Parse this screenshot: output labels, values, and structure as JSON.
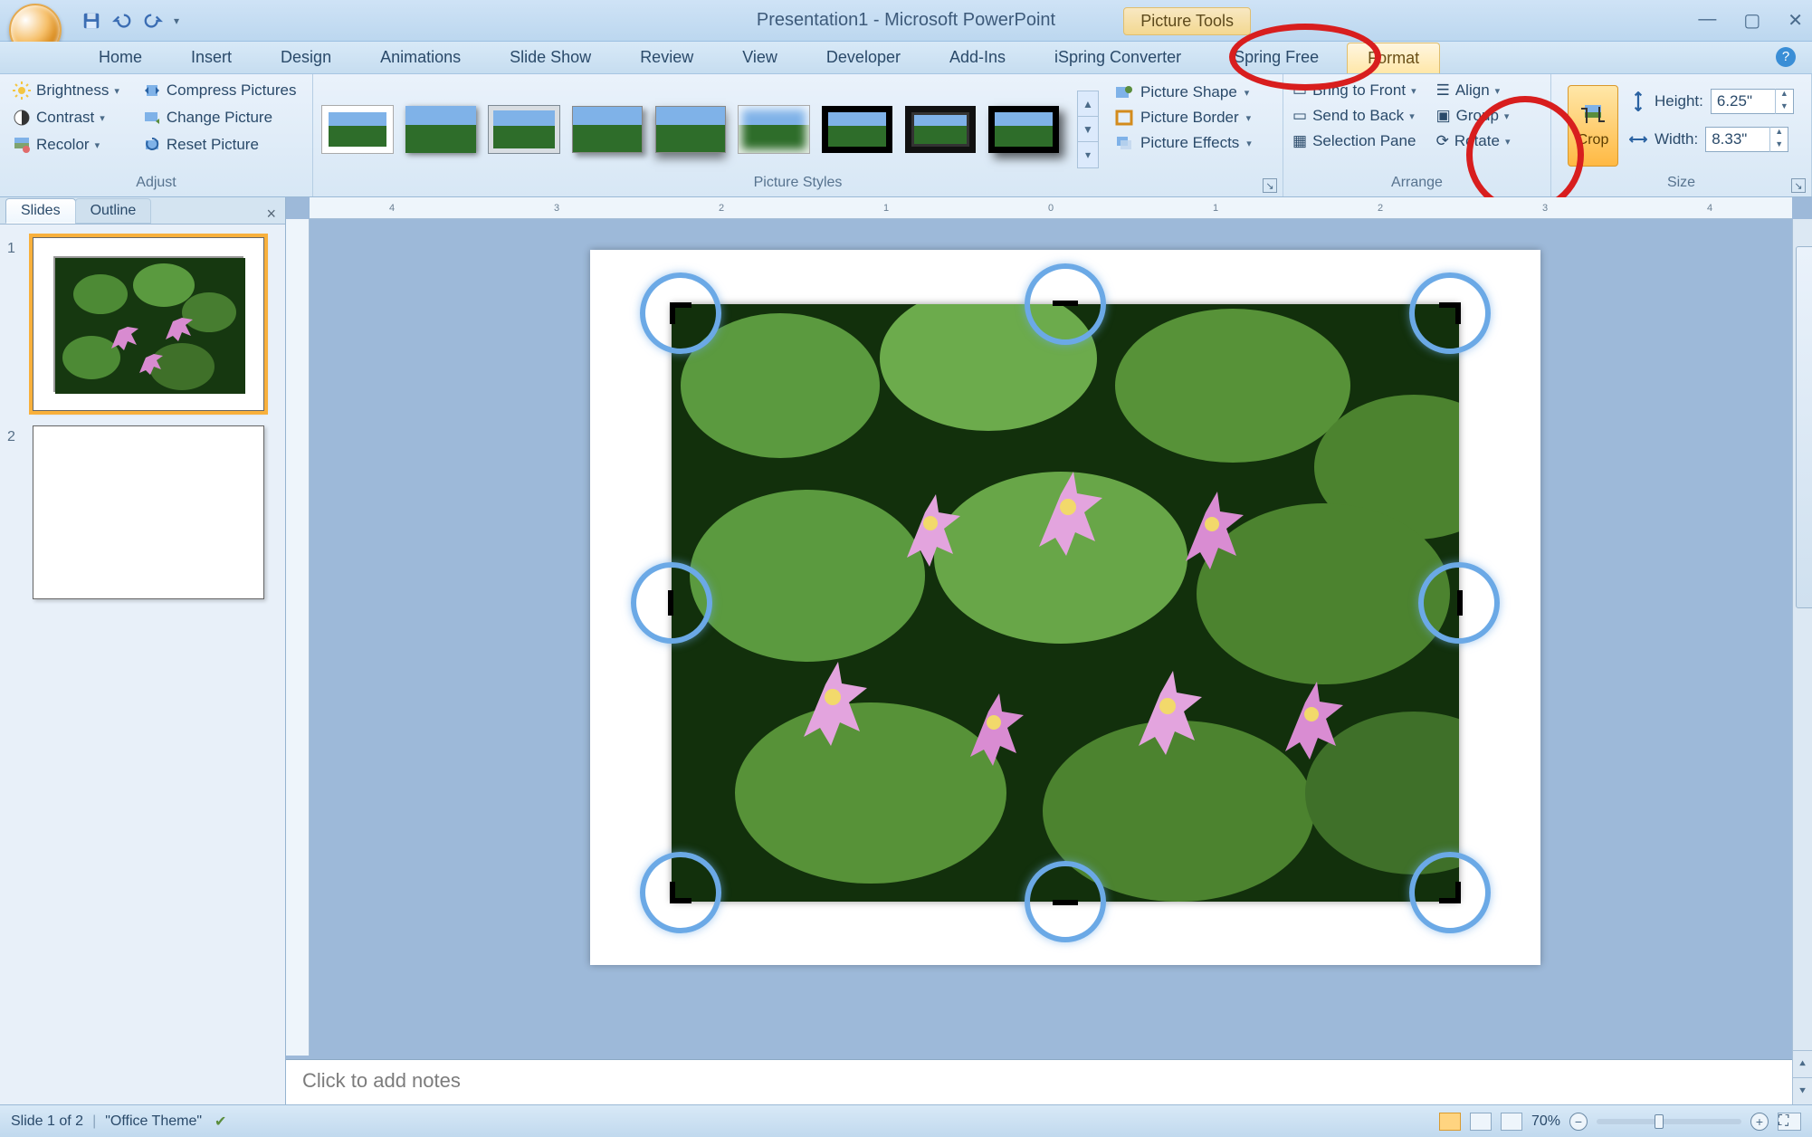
{
  "title": "Presentation1 - Microsoft PowerPoint",
  "contextual_tab": "Picture Tools",
  "tabs": [
    "Home",
    "Insert",
    "Design",
    "Animations",
    "Slide Show",
    "Review",
    "View",
    "Developer",
    "Add-Ins",
    "iSpring Converter",
    "iSpring Free",
    "Format"
  ],
  "active_tab": "Format",
  "ribbon": {
    "adjust": {
      "label": "Adjust",
      "brightness": "Brightness",
      "contrast": "Contrast",
      "recolor": "Recolor",
      "compress": "Compress Pictures",
      "change": "Change Picture",
      "reset": "Reset Picture"
    },
    "styles": {
      "label": "Picture Styles",
      "picture_shape": "Picture Shape",
      "picture_border": "Picture Border",
      "picture_effects": "Picture Effects"
    },
    "arrange": {
      "label": "Arrange",
      "bring_front": "Bring to Front",
      "send_back": "Send to Back",
      "selection_pane": "Selection Pane",
      "align": "Align",
      "group": "Group",
      "rotate": "Rotate"
    },
    "size": {
      "label": "Size",
      "crop": "Crop",
      "height_label": "Height:",
      "width_label": "Width:",
      "height_value": "6.25\"",
      "width_value": "8.33\""
    }
  },
  "panel": {
    "slides_tab": "Slides",
    "outline_tab": "Outline",
    "slide1_num": "1",
    "slide2_num": "2"
  },
  "notes_placeholder": "Click to add notes",
  "status": {
    "slide_of": "Slide 1 of 2",
    "theme": "\"Office Theme\"",
    "zoom": "70%"
  },
  "ruler_marks": [
    "4",
    "3",
    "2",
    "1",
    "0",
    "1",
    "2",
    "3",
    "4"
  ]
}
